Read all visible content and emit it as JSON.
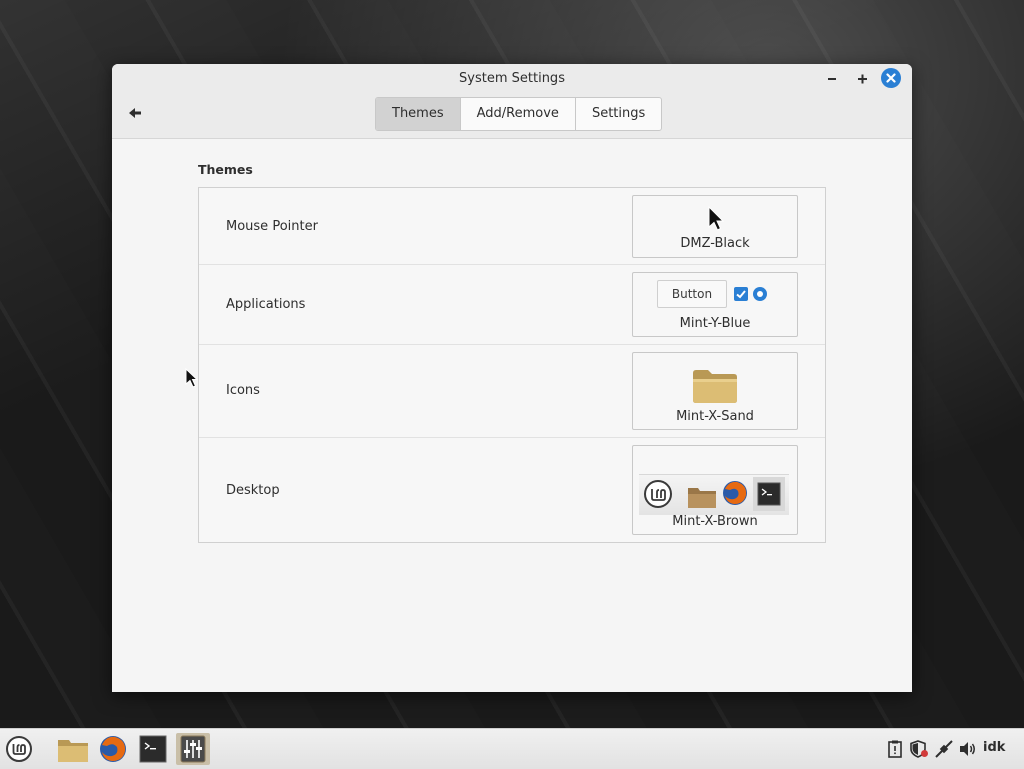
{
  "window": {
    "title": "System Settings",
    "tabs": [
      {
        "label": "Themes",
        "active": true
      },
      {
        "label": "Add/Remove",
        "active": false
      },
      {
        "label": "Settings",
        "active": false
      }
    ]
  },
  "section": {
    "title": "Themes"
  },
  "rows": [
    {
      "label": "Mouse Pointer",
      "value": "DMZ-Black",
      "preview": "cursor-icon"
    },
    {
      "label": "Applications",
      "value": "Mint-Y-Blue",
      "preview": "widget-preview",
      "preview_button_label": "Button"
    },
    {
      "label": "Icons",
      "value": "Mint-X-Sand",
      "preview": "folder-icon"
    },
    {
      "label": "Desktop",
      "value": "Mint-X-Brown",
      "preview": "panel-preview"
    }
  ],
  "taskbar": {
    "launchers": [
      "mint-menu-icon",
      "files-icon",
      "firefox-icon",
      "terminal-icon",
      "settings-icon"
    ],
    "tray_text": "idk"
  },
  "colors": {
    "accent": "#2a7fd4",
    "folder": "#d9b86a"
  }
}
